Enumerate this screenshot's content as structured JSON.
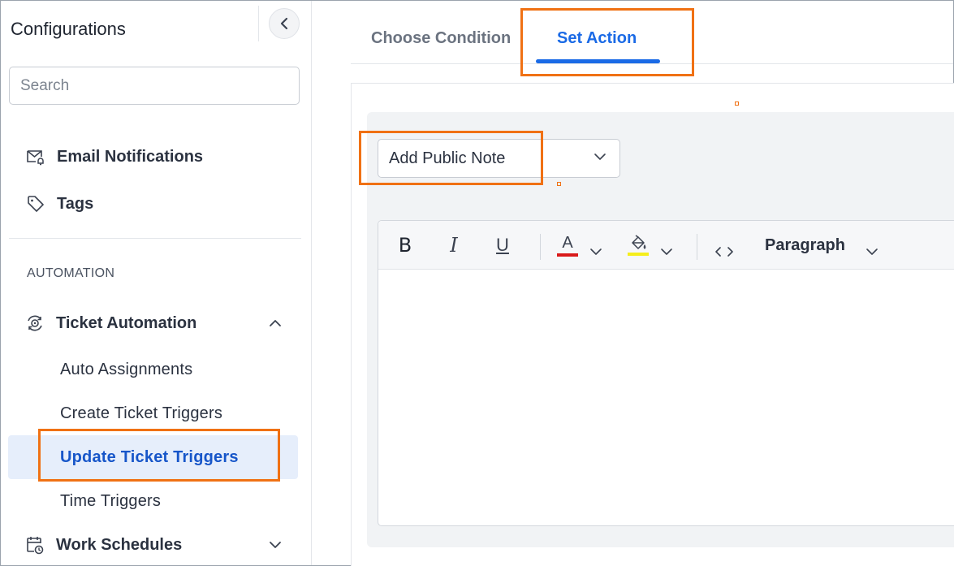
{
  "sidebar": {
    "title": "Configurations",
    "search_placeholder": "Search",
    "items": [
      {
        "label": "Email Notifications",
        "icon": "mail-bell-icon"
      },
      {
        "label": "Tags",
        "icon": "tag-icon"
      }
    ],
    "section_label": "AUTOMATION",
    "ticket_automation": {
      "label": "Ticket Automation",
      "icon": "automation-gear-icon",
      "expanded": true,
      "children": [
        {
          "label": "Auto Assignments"
        },
        {
          "label": "Create Ticket Triggers"
        },
        {
          "label": "Update Ticket Triggers",
          "active": true
        },
        {
          "label": "Time Triggers"
        }
      ]
    },
    "work_schedules": {
      "label": "Work Schedules",
      "icon": "calendar-clock-icon",
      "expanded": false
    }
  },
  "tabs": [
    {
      "label": "Choose Condition",
      "active": false
    },
    {
      "label": "Set Action",
      "active": true
    }
  ],
  "action_select": {
    "value": "Add Public Note"
  },
  "editor": {
    "toolbar": {
      "bold": "B",
      "italic": "I",
      "underline": "U",
      "font_color_glyph": "A",
      "block_format": "Paragraph"
    },
    "content": ""
  },
  "colors": {
    "accent": "#1a6ae6",
    "active_text": "#1756c9",
    "active_bg": "#e6eefb",
    "highlight": "#f07114",
    "font_color_bar": "#d91a1a",
    "bg_color_bar": "#f5ee1c"
  }
}
